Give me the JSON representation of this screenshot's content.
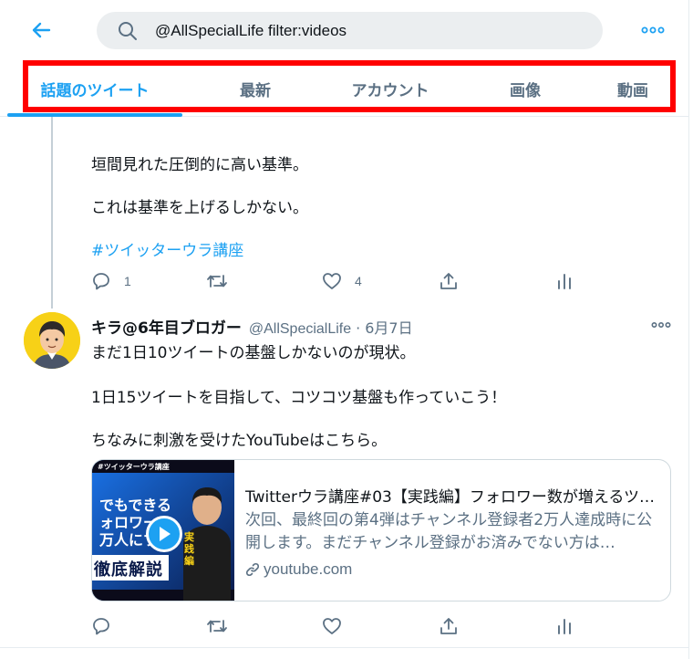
{
  "header": {
    "search_value": "@AllSpecialLife filter:videos"
  },
  "tabs": [
    {
      "label": "話題のツイート"
    },
    {
      "label": "最新"
    },
    {
      "label": "アカウント"
    },
    {
      "label": "画像"
    },
    {
      "label": "動画"
    }
  ],
  "tweet1": {
    "lines": [
      "垣間見れた圧倒的に高い基準。",
      "これは基準を上げるしかない。"
    ],
    "hashtag": "#ツイッターウラ講座",
    "reply_count": "1",
    "like_count": "4"
  },
  "tweet2": {
    "name": "キラ@6年目ブロガー",
    "handle": "@AllSpecialLife",
    "separator": "·",
    "date": "6月7日",
    "lines": [
      "まだ1日10ツイートの基盤しかないのが現状。",
      "1日15ツイートを目指して、コツコツ基盤も作っていこう！",
      "ちなみに刺激を受けたYouTubeはこちら。"
    ],
    "card": {
      "title": "Twitterウラ講座#03【実践編】フォロワー数が増えるツイート…",
      "description": "次回、最終回の第4弾はチャンネル登録者2万人達成時に公開します。まだチャンネル登録がお済みでない方は…",
      "domain": "youtube.com",
      "thumb_top_label": "#ツイッターウラ講座",
      "thumb_lines": [
        "でもできる",
        "ォロワー",
        "万人にする"
      ],
      "thumb_badge": "徹底解説",
      "thumb_side": "実践編"
    }
  },
  "icons": [
    "back-arrow-icon",
    "search-icon",
    "more-icon",
    "reply-icon",
    "retweet-icon",
    "like-icon",
    "share-icon",
    "analytics-icon",
    "link-icon",
    "play-icon"
  ],
  "colors": {
    "accent": "#1da1f2",
    "highlight": "#ff0000",
    "secondary_text": "#5b7083",
    "avatar_bg": "#f7d117"
  }
}
